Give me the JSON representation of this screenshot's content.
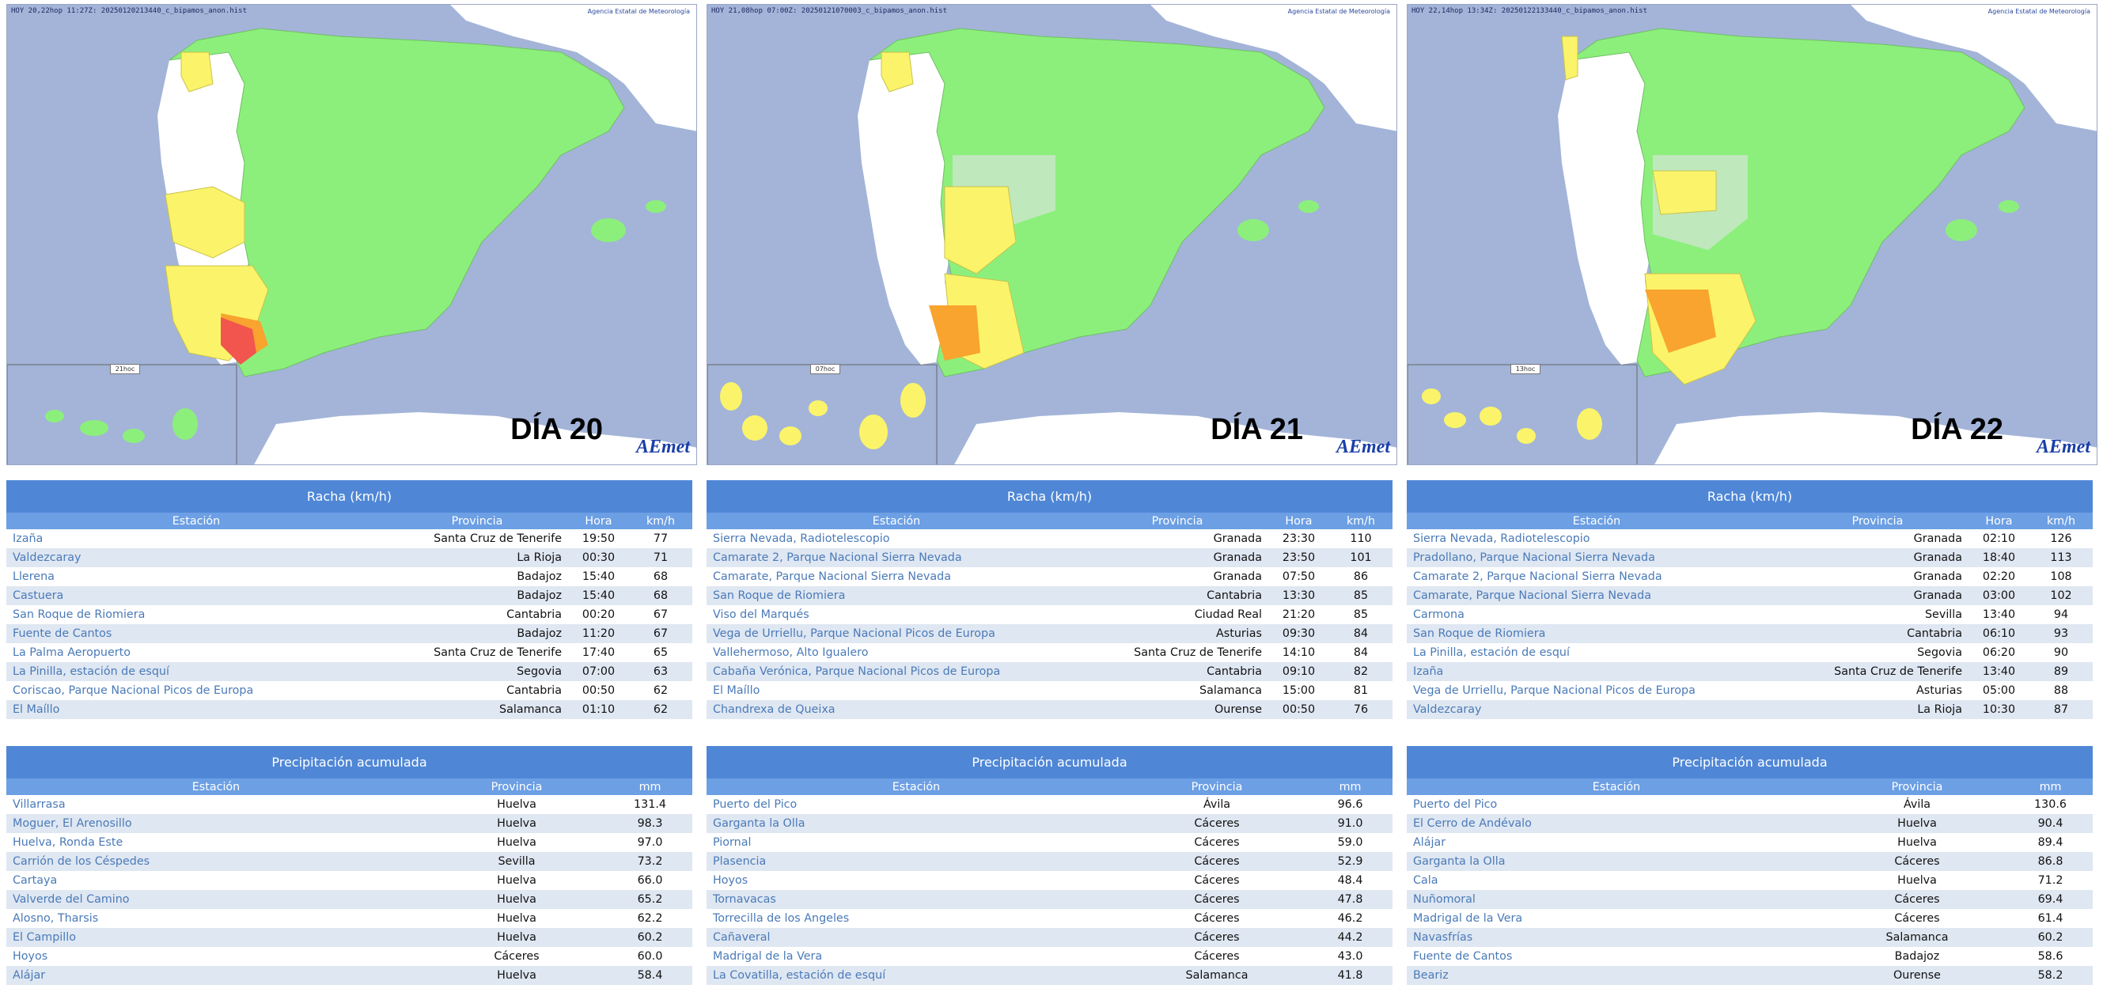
{
  "colors": {
    "green": "#8cef7c",
    "light_green": "#bfe8bd",
    "yellow": "#fbf46a",
    "orange": "#f8a42e",
    "red": "#f2554e",
    "sea": "#a3b4d8",
    "land": "#ffffff",
    "header": "#4f87d6"
  },
  "columns": {
    "station": "Estación",
    "province": "Provincia",
    "hour": "Hora",
    "kmh": "km/h",
    "mm": "mm"
  },
  "days": [
    {
      "map_header": "HOY 20,22hop 11:27Z: 20250120213440_c_bipamos_anon.hist",
      "credit": "Agencia Estatal de Meteorología",
      "time_label": "21hoc",
      "day_label": "DÍA 20",
      "logo": "AEmet",
      "racha_title": "Racha (km/h)",
      "racha": [
        {
          "station": "Izaña",
          "province": "Santa Cruz de Tenerife",
          "hour": "19:50",
          "value": "77"
        },
        {
          "station": "Valdezcaray",
          "province": "La Rioja",
          "hour": "00:30",
          "value": "71"
        },
        {
          "station": "Llerena",
          "province": "Badajoz",
          "hour": "15:40",
          "value": "68"
        },
        {
          "station": "Castuera",
          "province": "Badajoz",
          "hour": "15:40",
          "value": "68"
        },
        {
          "station": "San Roque de Riomiera",
          "province": "Cantabria",
          "hour": "00:20",
          "value": "67"
        },
        {
          "station": "Fuente de Cantos",
          "province": "Badajoz",
          "hour": "11:20",
          "value": "67"
        },
        {
          "station": "La Palma Aeropuerto",
          "province": "Santa Cruz de Tenerife",
          "hour": "17:40",
          "value": "65"
        },
        {
          "station": "La Pinilla, estación de esquí",
          "province": "Segovia",
          "hour": "07:00",
          "value": "63"
        },
        {
          "station": "Coriscao, Parque Nacional Picos de Europa",
          "province": "Cantabria",
          "hour": "00:50",
          "value": "62"
        },
        {
          "station": "El Maíllo",
          "province": "Salamanca",
          "hour": "01:10",
          "value": "62"
        }
      ],
      "precip_title": "Precipitación acumulada",
      "precip": [
        {
          "station": "Villarrasa",
          "province": "Huelva",
          "value": "131.4"
        },
        {
          "station": "Moguer, El Arenosillo",
          "province": "Huelva",
          "value": "98.3"
        },
        {
          "station": "Huelva, Ronda Este",
          "province": "Huelva",
          "value": "97.0"
        },
        {
          "station": "Carrión de los Céspedes",
          "province": "Sevilla",
          "value": "73.2"
        },
        {
          "station": "Cartaya",
          "province": "Huelva",
          "value": "66.0"
        },
        {
          "station": "Valverde del Camino",
          "province": "Huelva",
          "value": "65.2"
        },
        {
          "station": "Alosno, Tharsis",
          "province": "Huelva",
          "value": "62.2"
        },
        {
          "station": "El Campillo",
          "province": "Huelva",
          "value": "60.2"
        },
        {
          "station": "Hoyos",
          "province": "Cáceres",
          "value": "60.0"
        },
        {
          "station": "Alájar",
          "province": "Huelva",
          "value": "58.4"
        }
      ]
    },
    {
      "map_header": "HOY 21,08hop 07:00Z: 20250121070003_c_bipamos_anon.hist",
      "credit": "Agencia Estatal de Meteorología",
      "time_label": "07hoc",
      "day_label": "DÍA 21",
      "logo": "AEmet",
      "racha_title": "Racha (km/h)",
      "racha": [
        {
          "station": "Sierra Nevada, Radiotelescopio",
          "province": "Granada",
          "hour": "23:30",
          "value": "110"
        },
        {
          "station": "Camarate 2, Parque Nacional Sierra Nevada",
          "province": "Granada",
          "hour": "23:50",
          "value": "101"
        },
        {
          "station": "Camarate, Parque Nacional Sierra Nevada",
          "province": "Granada",
          "hour": "07:50",
          "value": "86"
        },
        {
          "station": "San Roque de Riomiera",
          "province": "Cantabria",
          "hour": "13:30",
          "value": "85"
        },
        {
          "station": "Viso del Marqués",
          "province": "Ciudad Real",
          "hour": "21:20",
          "value": "85"
        },
        {
          "station": "Vega de Urriellu, Parque Nacional Picos de Europa",
          "province": "Asturias",
          "hour": "09:30",
          "value": "84"
        },
        {
          "station": "Vallehermoso, Alto Igualero",
          "province": "Santa Cruz de Tenerife",
          "hour": "14:10",
          "value": "84"
        },
        {
          "station": "Cabaña Verónica, Parque Nacional Picos de Europa",
          "province": "Cantabria",
          "hour": "09:10",
          "value": "82"
        },
        {
          "station": "El Maíllo",
          "province": "Salamanca",
          "hour": "15:00",
          "value": "81"
        },
        {
          "station": "Chandrexa de Queixa",
          "province": "Ourense",
          "hour": "00:50",
          "value": "76"
        }
      ],
      "precip_title": "Precipitación acumulada",
      "precip": [
        {
          "station": "Puerto del Pico",
          "province": "Ávila",
          "value": "96.6"
        },
        {
          "station": "Garganta la Olla",
          "province": "Cáceres",
          "value": "91.0"
        },
        {
          "station": "Piornal",
          "province": "Cáceres",
          "value": "59.0"
        },
        {
          "station": "Plasencia",
          "province": "Cáceres",
          "value": "52.9"
        },
        {
          "station": "Hoyos",
          "province": "Cáceres",
          "value": "48.4"
        },
        {
          "station": "Tornavacas",
          "province": "Cáceres",
          "value": "47.8"
        },
        {
          "station": "Torrecilla de los Angeles",
          "province": "Cáceres",
          "value": "46.2"
        },
        {
          "station": "Cañaveral",
          "province": "Cáceres",
          "value": "44.2"
        },
        {
          "station": "Madrigal de la Vera",
          "province": "Cáceres",
          "value": "43.0"
        },
        {
          "station": "La Covatilla, estación de esquí",
          "province": "Salamanca",
          "value": "41.8"
        }
      ]
    },
    {
      "map_header": "HOY 22,14hop 13:34Z: 20250122133440_c_bipamos_anon.hist",
      "credit": "Agencia Estatal de Meteorología",
      "time_label": "13hoc",
      "day_label": "DÍA 22",
      "logo": "AEmet",
      "racha_title": "Racha (km/h)",
      "racha": [
        {
          "station": "Sierra Nevada, Radiotelescopio",
          "province": "Granada",
          "hour": "02:10",
          "value": "126"
        },
        {
          "station": "Pradollano, Parque Nacional Sierra Nevada",
          "province": "Granada",
          "hour": "18:40",
          "value": "113"
        },
        {
          "station": "Camarate 2, Parque Nacional Sierra Nevada",
          "province": "Granada",
          "hour": "02:20",
          "value": "108"
        },
        {
          "station": "Camarate, Parque Nacional Sierra Nevada",
          "province": "Granada",
          "hour": "03:00",
          "value": "102"
        },
        {
          "station": "Carmona",
          "province": "Sevilla",
          "hour": "13:40",
          "value": "94"
        },
        {
          "station": "San Roque de Riomiera",
          "province": "Cantabria",
          "hour": "06:10",
          "value": "93"
        },
        {
          "station": "La Pinilla, estación de esquí",
          "province": "Segovia",
          "hour": "06:20",
          "value": "90"
        },
        {
          "station": "Izaña",
          "province": "Santa Cruz de Tenerife",
          "hour": "13:40",
          "value": "89"
        },
        {
          "station": "Vega de Urriellu, Parque Nacional Picos de Europa",
          "province": "Asturias",
          "hour": "05:00",
          "value": "88"
        },
        {
          "station": "Valdezcaray",
          "province": "La Rioja",
          "hour": "10:30",
          "value": "87"
        }
      ],
      "precip_title": "Precipitación acumulada",
      "precip": [
        {
          "station": "Puerto del Pico",
          "province": "Ávila",
          "value": "130.6"
        },
        {
          "station": "El Cerro de Andévalo",
          "province": "Huelva",
          "value": "90.4"
        },
        {
          "station": "Alájar",
          "province": "Huelva",
          "value": "89.4"
        },
        {
          "station": "Garganta la Olla",
          "province": "Cáceres",
          "value": "86.8"
        },
        {
          "station": "Cala",
          "province": "Huelva",
          "value": "71.2"
        },
        {
          "station": "Nuñomoral",
          "province": "Cáceres",
          "value": "69.4"
        },
        {
          "station": "Madrigal de la Vera",
          "province": "Cáceres",
          "value": "61.4"
        },
        {
          "station": "Navasfrías",
          "province": "Salamanca",
          "value": "60.2"
        },
        {
          "station": "Fuente de Cantos",
          "province": "Badajoz",
          "value": "58.6"
        },
        {
          "station": "Beariz",
          "province": "Ourense",
          "value": "58.2"
        }
      ]
    }
  ]
}
